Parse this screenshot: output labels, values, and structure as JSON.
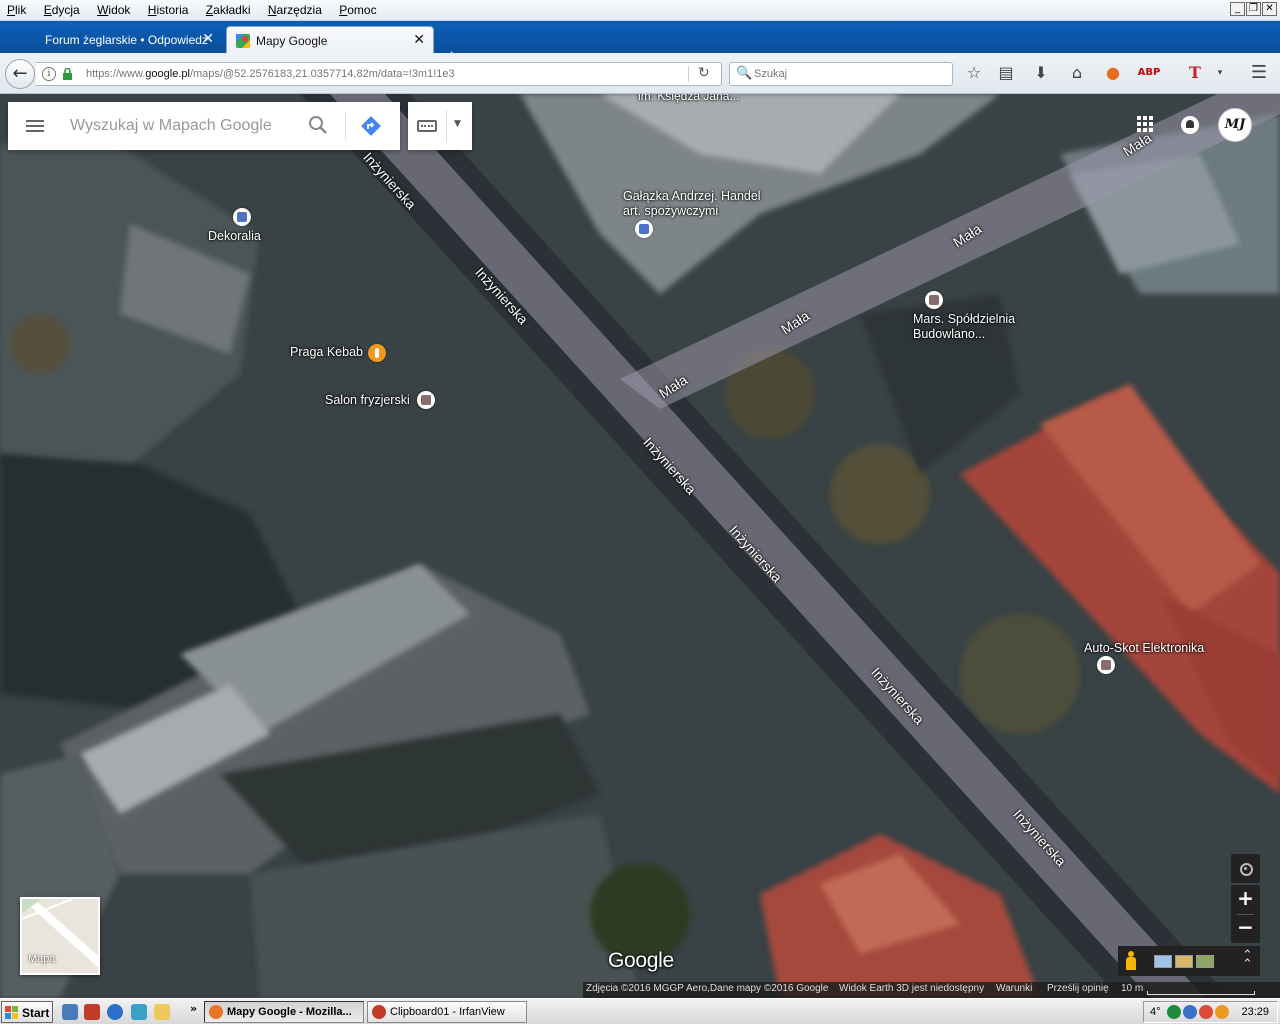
{
  "menubar": {
    "items": [
      "Plik",
      "Edycja",
      "Widok",
      "Historia",
      "Zakładki",
      "Narzędzia",
      "Pomoc"
    ],
    "window_controls": [
      "_",
      "❐",
      "✕"
    ]
  },
  "tabs": [
    {
      "title": "Forum żeglarskie • Odpowiedz",
      "active": false
    },
    {
      "title": "Mapy Google",
      "active": true
    }
  ],
  "new_tab_label": "+",
  "navbar": {
    "url_prefix": "https://www.",
    "url_domain": "google.pl",
    "url_rest": "/maps/@52.2576183,21.0357714,82m/data=!3m1!1e3",
    "search_placeholder": "Szukaj"
  },
  "maps": {
    "search_placeholder": "Wyszukaj w Mapach Google",
    "minimap_label": "Mapa",
    "google_logo": "Google",
    "avatar_text": "MJ",
    "attribution": {
      "imagery": "Zdjęcia ©2016 MGGP Aero,Dane mapy ©2016 Google",
      "earth": "Widok Earth 3D jest niedostępny",
      "terms": "Warunki",
      "feedback": "Prześlij opinię",
      "scale": "10 m"
    },
    "streets": {
      "inzynierska": "Inżynierska",
      "mala": "Mała",
      "ksiedza": "im. Księdza Jana..."
    },
    "pois": {
      "dekoralia": "Dekoralia",
      "galazka_line1": "Gałązka Andrzej. Handel",
      "galazka_line2": "art. spożywczymi",
      "praga_kebab": "Praga Kebab",
      "salon": "Salon fryzjerski",
      "mars_line1": "Mars. Spółdzielnia",
      "mars_line2": "Budowlano...",
      "autoskot": "Auto-Skot Elektronika"
    },
    "watermark": "© 2016 Google"
  },
  "taskbar": {
    "start_label": "Start",
    "more": "»",
    "tasks": [
      {
        "label": "Mapy Google - Mozilla..."
      },
      {
        "label": "Clipboard01 - IrfanView"
      }
    ],
    "temp": "4°",
    "clock": "23:29"
  },
  "colors": {
    "titlebar_blue": "#0a56aa",
    "road_overlay": "#9a96a8",
    "accent_blue": "#4285f4"
  }
}
